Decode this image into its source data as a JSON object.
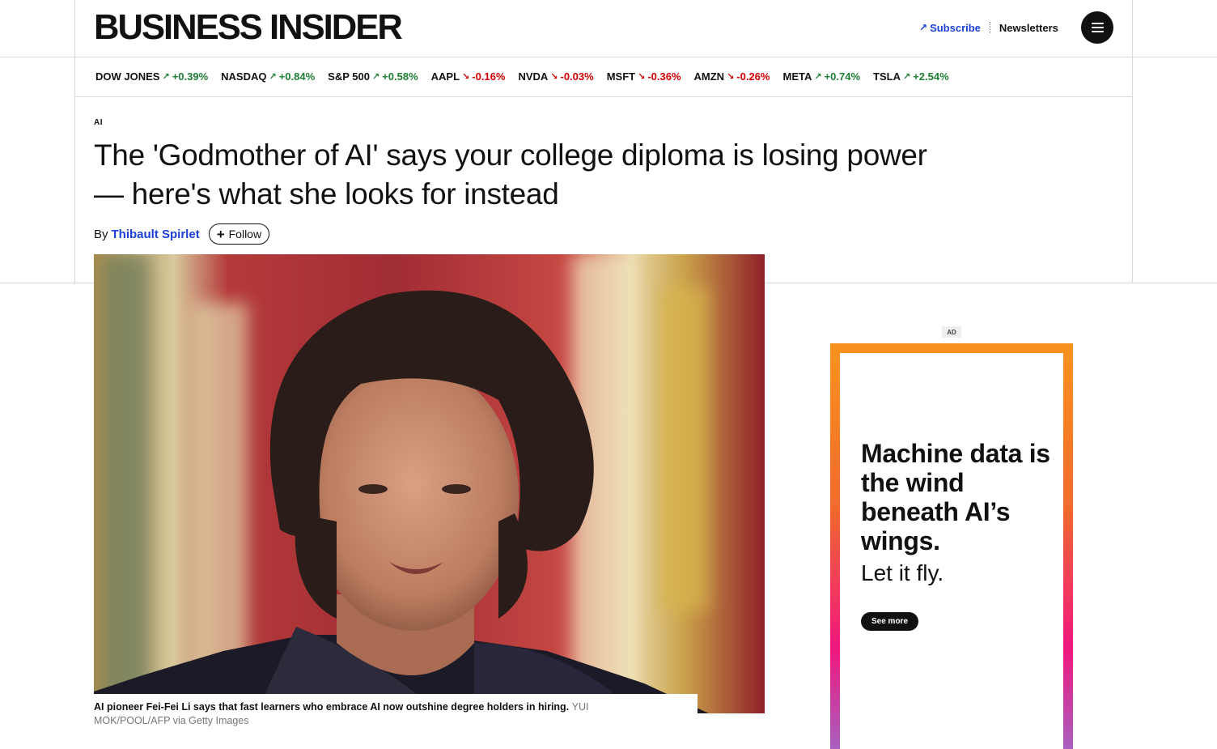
{
  "header": {
    "logo": "BUSINESS INSIDER",
    "subscribe_label": "Subscribe",
    "newsletters_label": "Newsletters",
    "menu_icon": "hamburger-menu-icon"
  },
  "ticker": [
    {
      "symbol": "DOW JONES",
      "change": "+0.39%",
      "direction": "up"
    },
    {
      "symbol": "NASDAQ",
      "change": "+0.84%",
      "direction": "up"
    },
    {
      "symbol": "S&P 500",
      "change": "+0.58%",
      "direction": "up"
    },
    {
      "symbol": "AAPL",
      "change": "-0.16%",
      "direction": "down"
    },
    {
      "symbol": "NVDA",
      "change": "-0.03%",
      "direction": "down"
    },
    {
      "symbol": "MSFT",
      "change": "-0.36%",
      "direction": "down"
    },
    {
      "symbol": "AMZN",
      "change": "-0.26%",
      "direction": "down"
    },
    {
      "symbol": "META",
      "change": "+0.74%",
      "direction": "up"
    },
    {
      "symbol": "TSLA",
      "change": "+2.54%",
      "direction": "up"
    }
  ],
  "article": {
    "category": "AI",
    "headline": "The 'Godmother of AI' says your college diploma is losing power — here's what she looks for instead",
    "by_prefix": "By",
    "author": "Thibault Spirlet",
    "follow_label": "Follow",
    "caption": "AI pioneer Fei-Fei Li says that fast learners who embrace AI now outshine degree holders in hiring.",
    "credit": "YUI MOK/POOL/AFP via Getty Images"
  },
  "ad": {
    "label": "AD",
    "title": "Machine data is the wind beneath AI’s wings.",
    "subtitle": "Let it fly.",
    "button_label": "See more"
  },
  "colors": {
    "link_blue": "#1b3fd7",
    "up_green": "#1e7e34",
    "down_red": "#d40000"
  }
}
